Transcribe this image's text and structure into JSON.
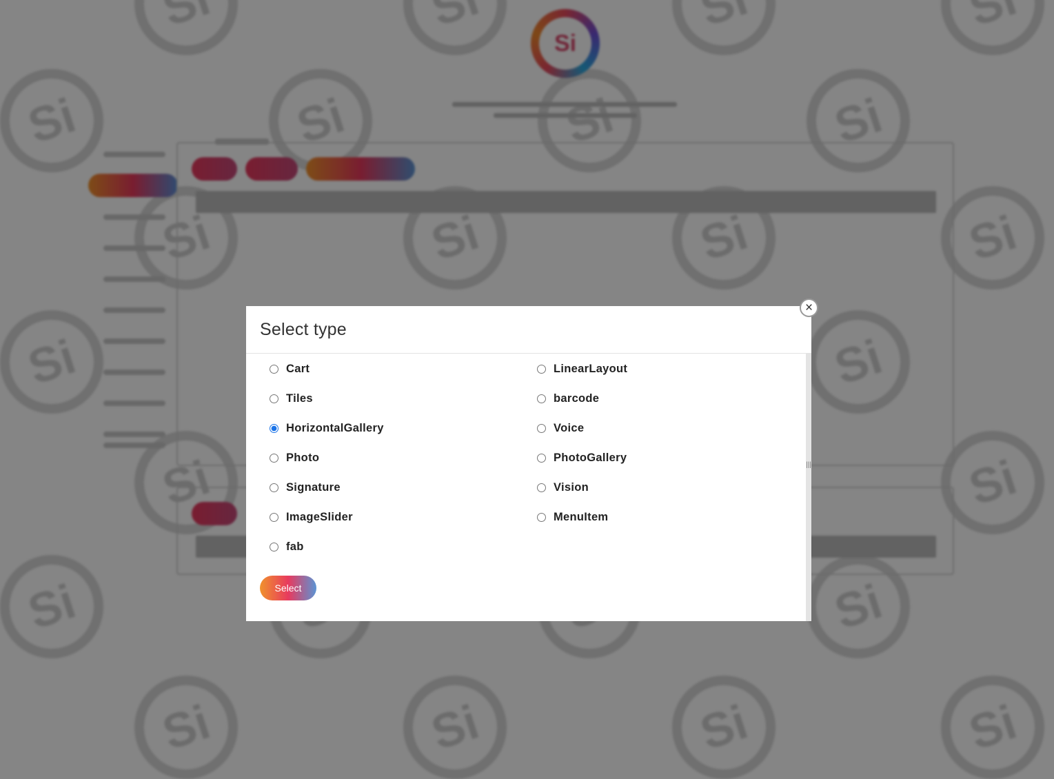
{
  "modal": {
    "title": "Select type",
    "close_glyph": "×",
    "select_label": "Select",
    "options_left": [
      "Cart",
      "Tiles",
      "HorizontalGallery",
      "Photo",
      "Signature",
      "ImageSlider",
      "fab"
    ],
    "options_right": [
      "LinearLayout",
      "barcode",
      "Voice",
      "PhotoGallery",
      "Vision",
      "MenuItem"
    ],
    "selected": "HorizontalGallery"
  },
  "background": {
    "logo_text": "Si",
    "watermark_text": "Si"
  },
  "icons": {
    "close": "close-icon",
    "scroll_grip": "grip-icon"
  },
  "colors": {
    "accent_gradient_start": "#f0922c",
    "accent_gradient_mid": "#e83a5e",
    "accent_gradient_end": "#5b94d4",
    "radio_selected": "#1a73e8"
  }
}
